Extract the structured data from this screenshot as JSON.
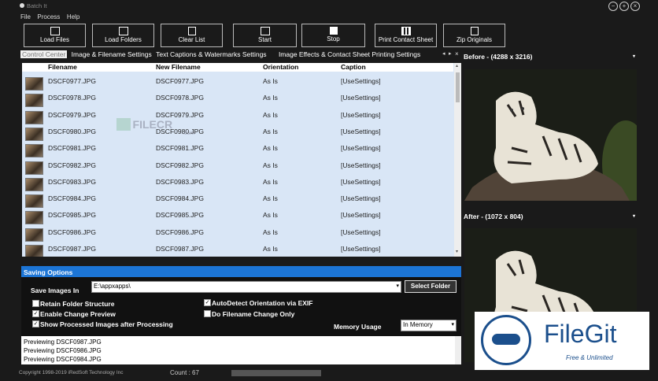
{
  "window": {
    "title": "Batch It"
  },
  "menu": [
    "File",
    "Process",
    "Help"
  ],
  "toolbar": [
    {
      "label": "Load Files",
      "icon": "image-icon"
    },
    {
      "label": "Load Folders",
      "icon": "image-icon"
    },
    {
      "label": "Clear List",
      "icon": "document-icon"
    },
    {
      "label": "Start",
      "icon": "play-icon"
    },
    {
      "label": "Stop",
      "icon": "stop-icon"
    },
    {
      "label": "Print Contact Sheet",
      "icon": "grid-icon"
    },
    {
      "label": "Zip Originals",
      "icon": "zip-icon"
    }
  ],
  "tabs": [
    "Control Center",
    "Image & Filename Settings",
    "Text Captions & Watermarks Settings",
    "Image Effects & Contact Sheet Printing Settings"
  ],
  "list": {
    "headers": {
      "filename": "Filename",
      "new_filename": "New Filename",
      "orientation": "Orientation",
      "caption": "Caption"
    },
    "rows": [
      {
        "filename": "DSCF0977.JPG",
        "new_filename": "DSCF0977.JPG",
        "orientation": "As Is",
        "caption": "[UseSettings]"
      },
      {
        "filename": "DSCF0978.JPG",
        "new_filename": "DSCF0978.JPG",
        "orientation": "As Is",
        "caption": "[UseSettings]"
      },
      {
        "filename": "DSCF0979.JPG",
        "new_filename": "DSCF0979.JPG",
        "orientation": "As Is",
        "caption": "[UseSettings]"
      },
      {
        "filename": "DSCF0980.JPG",
        "new_filename": "DSCF0980.JPG",
        "orientation": "As Is",
        "caption": "[UseSettings]"
      },
      {
        "filename": "DSCF0981.JPG",
        "new_filename": "DSCF0981.JPG",
        "orientation": "As Is",
        "caption": "[UseSettings]"
      },
      {
        "filename": "DSCF0982.JPG",
        "new_filename": "DSCF0982.JPG",
        "orientation": "As Is",
        "caption": "[UseSettings]"
      },
      {
        "filename": "DSCF0983.JPG",
        "new_filename": "DSCF0983.JPG",
        "orientation": "As Is",
        "caption": "[UseSettings]"
      },
      {
        "filename": "DSCF0984.JPG",
        "new_filename": "DSCF0984.JPG",
        "orientation": "As Is",
        "caption": "[UseSettings]"
      },
      {
        "filename": "DSCF0985.JPG",
        "new_filename": "DSCF0985.JPG",
        "orientation": "As Is",
        "caption": "[UseSettings]"
      },
      {
        "filename": "DSCF0986.JPG",
        "new_filename": "DSCF0986.JPG",
        "orientation": "As Is",
        "caption": "[UseSettings]"
      },
      {
        "filename": "DSCF0987.JPG",
        "new_filename": "DSCF0987.JPG",
        "orientation": "As Is",
        "caption": "[UseSettings]"
      }
    ]
  },
  "preview": {
    "before_label": "Before - (4288 x 3216)",
    "after_label": "After - (1072 x 804)"
  },
  "saving": {
    "title": "Saving Options",
    "save_images_in_label": "Save Images In",
    "path": "E:\\appxapps\\",
    "select_folder": "Select Folder",
    "options": [
      {
        "label": "Retain Folder Structure",
        "checked": false
      },
      {
        "label": "Enable Change Preview",
        "checked": true
      },
      {
        "label": "Show Processed Images after Processing",
        "checked": true
      },
      {
        "label": "AutoDetect Orientation via EXIF",
        "checked": true
      },
      {
        "label": "Do Filename Change Only",
        "checked": false
      }
    ],
    "memory_label": "Memory Usage",
    "memory_value": "In Memory"
  },
  "log": [
    "Previewing DSCF0987.JPG",
    "Previewing DSCF0986.JPG",
    "Previewing DSCF0984.JPG"
  ],
  "status": {
    "copyright": "Copyright 1998-2019 iRedSoft Technology Inc",
    "count": "Count : 67"
  },
  "watermark": {
    "center_text": "FILECR",
    "center_sub": ".com",
    "badge_title": "FileGit",
    "badge_sub": "Free & Unlimited"
  },
  "colors": {
    "accent": "#1c75d6",
    "list_bg": "#d9e6f6"
  }
}
